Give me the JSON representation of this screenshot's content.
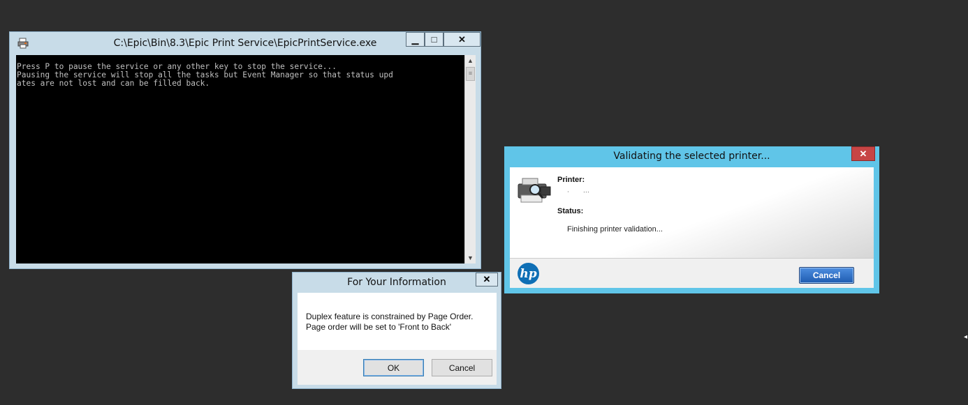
{
  "console": {
    "title": "C:\\Epic\\Bin\\8.3\\Epic Print Service\\EpicPrintService.exe",
    "minimize": "▁",
    "maximize": "□",
    "close": "✕",
    "output": "Press P to pause the service or any other key to stop the service...\nPausing the service will stop all the tasks but Event Manager so that status upd\nates are not lost and can be filled back.",
    "scroll_up": "▲",
    "scroll_down": "▼",
    "scroll_thumb": "≡"
  },
  "fyi_dialog": {
    "title": "For Your Information",
    "close": "✕",
    "message_line1": "Duplex feature is constrained by Page Order.",
    "message_line2": "Page order will be set to 'Front to Back'",
    "ok_label": "OK",
    "cancel_label": "Cancel"
  },
  "hp_dialog": {
    "title": "Validating the selected printer...",
    "close": "✕",
    "printer_label": "Printer:",
    "status_label": "Status:",
    "status_text": "Finishing printer validation...",
    "logo_text": "hp",
    "cancel_label": "Cancel"
  }
}
